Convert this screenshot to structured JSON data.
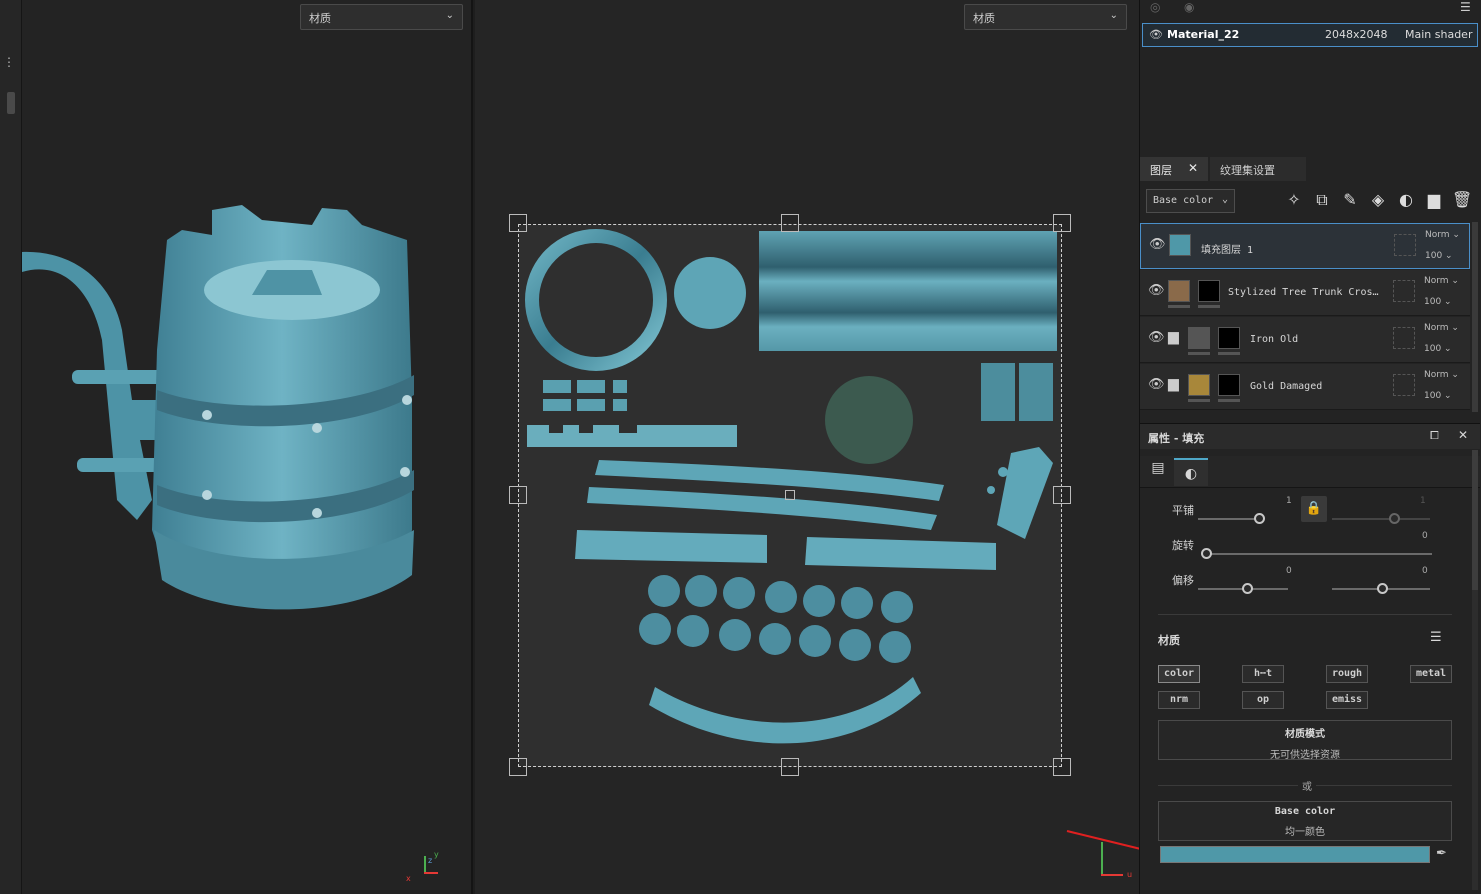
{
  "left_viewport": {
    "material_select": "材质"
  },
  "uv_viewport": {
    "material_select": "材质"
  },
  "texture_set": {
    "name": "Material_22",
    "resolution": "2048x2048",
    "shader": "Main shader"
  },
  "panel_tabs": {
    "layers": "图层",
    "texture_set_settings": "纹理集设置"
  },
  "channel_select": "Base color",
  "layers": [
    {
      "name": "填充图层 1",
      "blend": "Norm",
      "opacity": "100",
      "selected": true
    },
    {
      "name": "Stylized Tree Trunk Cros…",
      "blend": "Norm",
      "opacity": "100",
      "selected": false
    },
    {
      "name": "Iron Old",
      "blend": "Norm",
      "opacity": "100",
      "selected": false
    },
    {
      "name": "Gold Damaged",
      "blend": "Norm",
      "opacity": "100",
      "selected": false
    }
  ],
  "properties": {
    "title": "属性 - 填充",
    "tiling_label": "平铺",
    "tiling_value": "1",
    "tiling_value_locked": "1",
    "rotation_label": "旋转",
    "rotation_value": "0",
    "offset_label": "偏移",
    "offset_x": "0",
    "offset_y": "0",
    "material_section": "材质",
    "channels": [
      "color",
      "h⋯t",
      "rough",
      "metal",
      "nrm",
      "op",
      "emiss"
    ],
    "material_mode_title": "材质模式",
    "material_mode_sub": "无可供选择资源",
    "or_label": "或",
    "base_color_title": "Base color",
    "base_color_sub": "均一颜色",
    "base_color_hex": "#4f98a8"
  },
  "axes_3d": {
    "x": "x",
    "z": "z",
    "y": "y"
  },
  "axes_uv": {
    "u": "u",
    "v": "v"
  }
}
